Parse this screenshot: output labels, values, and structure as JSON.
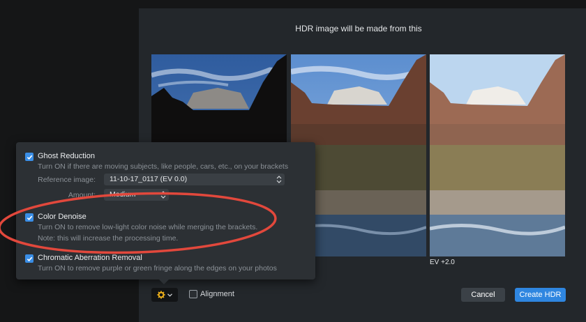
{
  "dialog": {
    "title": "HDR image will be made from this",
    "ev_label": "EV +2.0",
    "cancel_label": "Cancel",
    "create_label": "Create HDR",
    "alignment_label": "Alignment"
  },
  "panel": {
    "ghost": {
      "title": "Ghost Reduction",
      "desc": "Turn ON if there are moving subjects, like people, cars, etc., on your brackets",
      "checked": true,
      "reference_label": "Reference image:",
      "reference_value": "11-10-17_0117 (EV 0.0)",
      "amount_label": "Amount:",
      "amount_value": "Medium"
    },
    "denoise": {
      "title": "Color Denoise",
      "desc1": "Turn ON to remove low-light color noise while merging the brackets.",
      "desc2": "Note: this will increase the processing time.",
      "checked": true
    },
    "chromatic": {
      "title": "Chromatic Aberration Removal",
      "desc": "Turn ON to remove purple or green fringe along the edges on your photos",
      "checked": true
    }
  },
  "colors": {
    "accent": "#2f86e0",
    "checkbox": "#3a8ee6",
    "highlight_ring": "#e2483c",
    "dialog_bg": "#23272b",
    "panel_bg": "#2c3034"
  },
  "icons": [
    "gear-icon",
    "chevron-down-icon",
    "checkmark-icon",
    "updown-arrows-icon"
  ]
}
